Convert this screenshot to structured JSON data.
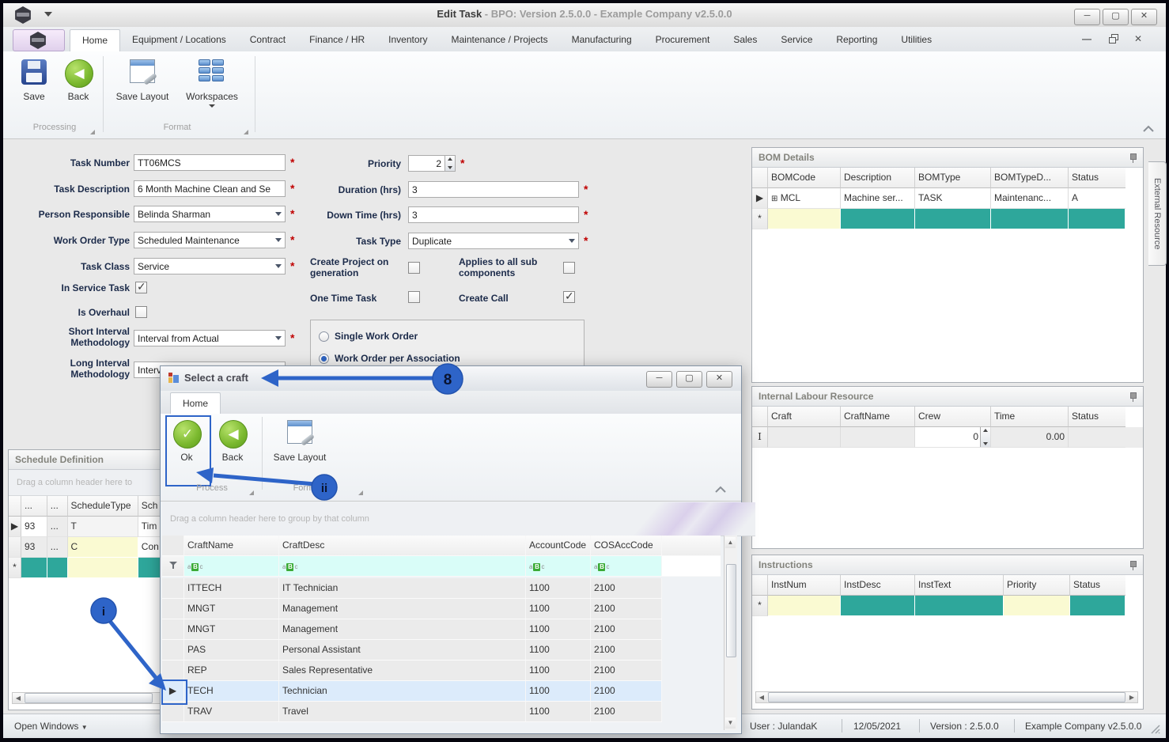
{
  "titlebar": {
    "title_bold": "Edit Task",
    "title_rest": " - BPO: Version 2.5.0.0 - Example Company v2.5.0.0",
    "minimize": "─",
    "maximize": "▢",
    "close": "✕"
  },
  "tabs": {
    "items": [
      {
        "label": "Home"
      },
      {
        "label": "Equipment / Locations"
      },
      {
        "label": "Contract"
      },
      {
        "label": "Finance / HR"
      },
      {
        "label": "Inventory"
      },
      {
        "label": "Maintenance / Projects"
      },
      {
        "label": "Manufacturing"
      },
      {
        "label": "Procurement"
      },
      {
        "label": "Sales"
      },
      {
        "label": "Service"
      },
      {
        "label": "Reporting"
      },
      {
        "label": "Utilities"
      }
    ]
  },
  "ribbon": {
    "save": "Save",
    "back": "Back",
    "save_layout": "Save Layout",
    "workspaces": "Workspaces",
    "group_processing": "Processing",
    "group_format": "Format"
  },
  "form": {
    "task_number": {
      "label": "Task Number",
      "value": "TT06MCS"
    },
    "task_description": {
      "label": "Task Description",
      "value": "6 Month Machine Clean and Se"
    },
    "person_responsible": {
      "label": "Person Responsible",
      "value": "Belinda Sharman"
    },
    "work_order_type": {
      "label": "Work Order Type",
      "value": "Scheduled Maintenance"
    },
    "task_class": {
      "label": "Task Class",
      "value": "Service"
    },
    "in_service_task": {
      "label": "In Service Task",
      "checked": true
    },
    "is_overhaul": {
      "label": "Is Overhaul",
      "checked": false
    },
    "short_interval": {
      "label": "Short Interval Methodology",
      "value": "Interval from Actual"
    },
    "long_interval": {
      "label": "Long Interval Methodology",
      "value": "Interval Enforced"
    },
    "priority": {
      "label": "Priority",
      "value": "2"
    },
    "duration": {
      "label": "Duration (hrs)",
      "value": "3"
    },
    "down_time": {
      "label": "Down Time (hrs)",
      "value": "3"
    },
    "task_type": {
      "label": "Task Type",
      "value": "Duplicate"
    },
    "create_project": {
      "label": "Create Project on generation",
      "checked": false
    },
    "applies_sub": {
      "label": "Applies to all sub components",
      "checked": false
    },
    "one_time_task": {
      "label": "One Time Task",
      "checked": false
    },
    "create_call": {
      "label": "Create Call",
      "checked": true
    },
    "radio_single": {
      "label": "Single Work Order",
      "selected": false
    },
    "radio_per_assoc": {
      "label": "Work Order per Association",
      "selected": true
    }
  },
  "bom": {
    "title": "BOM Details",
    "columns": [
      "BOMCode",
      "Description",
      "BOMType",
      "BOMTypeD...",
      "Status"
    ],
    "row": {
      "code": "MCL",
      "desc": "Machine ser...",
      "type": "TASK",
      "typedesc": "Maintenanc...",
      "status": "A"
    }
  },
  "labour": {
    "title": "Internal Labour Resource",
    "columns": [
      "Craft",
      "CraftName",
      "Crew",
      "Time",
      "Status"
    ],
    "row": {
      "crew": "0",
      "time": "0.00"
    }
  },
  "instructions": {
    "title": "Instructions",
    "columns": [
      "InstNum",
      "InstDesc",
      "InstText",
      "Priority",
      "Status"
    ]
  },
  "schedule": {
    "title": "Schedule Definition",
    "drag_hint": "Drag a column header here to",
    "columns": {
      "c1": "...",
      "c2": "...",
      "c3": "ScheduleType",
      "c4": "Sch"
    },
    "rows": [
      {
        "num": "93",
        "dots": "...",
        "type": "T",
        "extra": "Tim"
      },
      {
        "num": "93",
        "dots": "...",
        "type": "C",
        "extra": "Con"
      }
    ]
  },
  "external_tab": "External Resource",
  "modal": {
    "title": "Select a craft",
    "tab": "Home",
    "toolbar": {
      "ok": "Ok",
      "back": "Back",
      "save_layout": "Save Layout",
      "group_process": "Process",
      "group_format": "Format"
    },
    "drag_hint": "Drag a column header here to group by that column",
    "grid": {
      "columns": [
        "CraftName",
        "CraftDesc",
        "AccountCode",
        "COSAccCode"
      ],
      "filter": {
        "a": "a",
        "b": "B",
        "c": "c"
      },
      "rows": [
        {
          "name": "ITTECH",
          "desc": "IT Technician",
          "account": "1100",
          "cos": "2100"
        },
        {
          "name": "MNGT",
          "desc": "Management",
          "account": "1100",
          "cos": "2100"
        },
        {
          "name": "MNGT",
          "desc": "Management",
          "account": "1100",
          "cos": "2100"
        },
        {
          "name": "PAS",
          "desc": "Personal Assistant",
          "account": "1100",
          "cos": "2100"
        },
        {
          "name": "REP",
          "desc": "Sales Representative",
          "account": "1100",
          "cos": "2100"
        },
        {
          "name": "TECH",
          "desc": "Technician",
          "account": "1100",
          "cos": "2100",
          "selected": true
        },
        {
          "name": "TRAV",
          "desc": "Travel",
          "account": "1100",
          "cos": "2100"
        }
      ]
    }
  },
  "statusbar": {
    "open_windows": "Open Windows",
    "user": "User : JulandaK",
    "date": "12/05/2021",
    "version": "Version : 2.5.0.0",
    "company": "Example Company v2.5.0.0"
  },
  "annotations": {
    "n8": "8",
    "nii": "ii",
    "ni": "i"
  },
  "colors": {
    "teal": "#2EA79B",
    "yellow": "#FAFAD2",
    "filter_cyan": "#D9FDF8",
    "selection_blue": "#DCEBFB",
    "annotation_blue": "#2E64C8",
    "asterisk_red": "#C00000"
  }
}
